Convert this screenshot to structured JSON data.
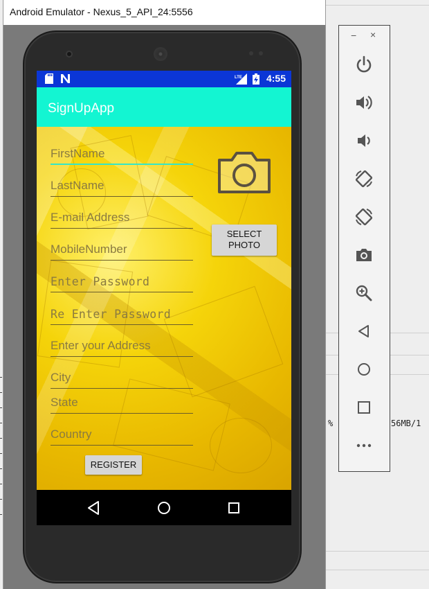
{
  "window": {
    "title": "Android Emulator - Nexus_5_API_24:5556"
  },
  "status_bar": {
    "time": "4:55"
  },
  "app": {
    "title": "SignUpApp"
  },
  "form": {
    "fields": [
      {
        "key": "first_name",
        "placeholder": "FirstName",
        "active": true
      },
      {
        "key": "last_name",
        "placeholder": "LastName"
      },
      {
        "key": "email",
        "placeholder": "E-mail Address"
      },
      {
        "key": "mobile",
        "placeholder": "MobileNumber"
      },
      {
        "key": "password",
        "placeholder": "Enter Password"
      },
      {
        "key": "re_password",
        "placeholder": "Re Enter Password"
      },
      {
        "key": "address",
        "placeholder": "Enter your Address"
      },
      {
        "key": "city",
        "placeholder": "City"
      },
      {
        "key": "state",
        "placeholder": "State"
      },
      {
        "key": "country",
        "placeholder": "Country"
      }
    ],
    "select_photo_line1": "SELECT",
    "select_photo_line2": "PHOTO",
    "register_label": "REGISTER"
  },
  "side_panel": {
    "minimize_label": "−",
    "close_label": "×",
    "buttons": [
      "power-icon",
      "volume-up-icon",
      "volume-down-icon",
      "rotate-left-icon",
      "rotate-right-icon",
      "camera-icon",
      "zoom-icon",
      "back-icon",
      "home-icon",
      "overview-icon",
      "more-icon"
    ]
  },
  "background": {
    "percent_text": "%",
    "memory_text": "56MB/1"
  },
  "colors": {
    "status_bar": "#0b36d6",
    "app_bar": "#13f5d2",
    "field_active_line": "#33e6c8"
  }
}
